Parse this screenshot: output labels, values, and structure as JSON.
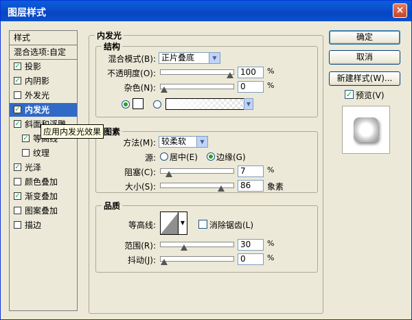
{
  "window": {
    "title": "图层样式",
    "close": "×"
  },
  "styles": {
    "header": "样式",
    "blend_options": "混合选项:自定",
    "items": [
      {
        "label": "投影",
        "checked": true
      },
      {
        "label": "内阴影",
        "checked": true
      },
      {
        "label": "外发光",
        "checked": false
      },
      {
        "label": "内发光",
        "checked": true,
        "selected": true
      },
      {
        "label": "斜面和浮雕",
        "checked": true
      },
      {
        "label": "等高线",
        "checked": true,
        "sub": true
      },
      {
        "label": "纹理",
        "checked": false,
        "sub": true
      },
      {
        "label": "光泽",
        "checked": true
      },
      {
        "label": "颜色叠加",
        "checked": false
      },
      {
        "label": "渐变叠加",
        "checked": true
      },
      {
        "label": "图案叠加",
        "checked": false
      },
      {
        "label": "描边",
        "checked": false
      }
    ],
    "tooltip": "应用内发光效果"
  },
  "panel_title": "内发光",
  "structure": {
    "legend": "结构",
    "blend_mode_label": "混合模式(B):",
    "blend_mode_value": "正片叠底",
    "opacity_label": "不透明度(O):",
    "opacity_value": "100",
    "noise_label": "杂色(N):",
    "noise_value": "0",
    "unit": "%"
  },
  "elements": {
    "legend": "图素",
    "method_label": "方法(M):",
    "method_value": "较柔软",
    "source_label": "源:",
    "source_center": "居中(E)",
    "source_edge": "边缘(G)",
    "choke_label": "阻塞(C):",
    "choke_value": "7",
    "size_label": "大小(S):",
    "size_value": "86",
    "size_unit": "象素",
    "unit": "%"
  },
  "quality": {
    "legend": "品质",
    "contour_label": "等高线:",
    "anti_alias_label": "消除锯齿(L)",
    "range_label": "范围(R):",
    "range_value": "30",
    "jitter_label": "抖动(J):",
    "jitter_value": "0",
    "unit": "%"
  },
  "buttons": {
    "ok": "确定",
    "cancel": "取消",
    "new_style": "新建样式(W)...",
    "preview_label": "预览(V)"
  },
  "levels": {
    "opacity": 100,
    "noise": 0,
    "choke": 7,
    "size": 86,
    "range": 30,
    "jitter": 0
  }
}
